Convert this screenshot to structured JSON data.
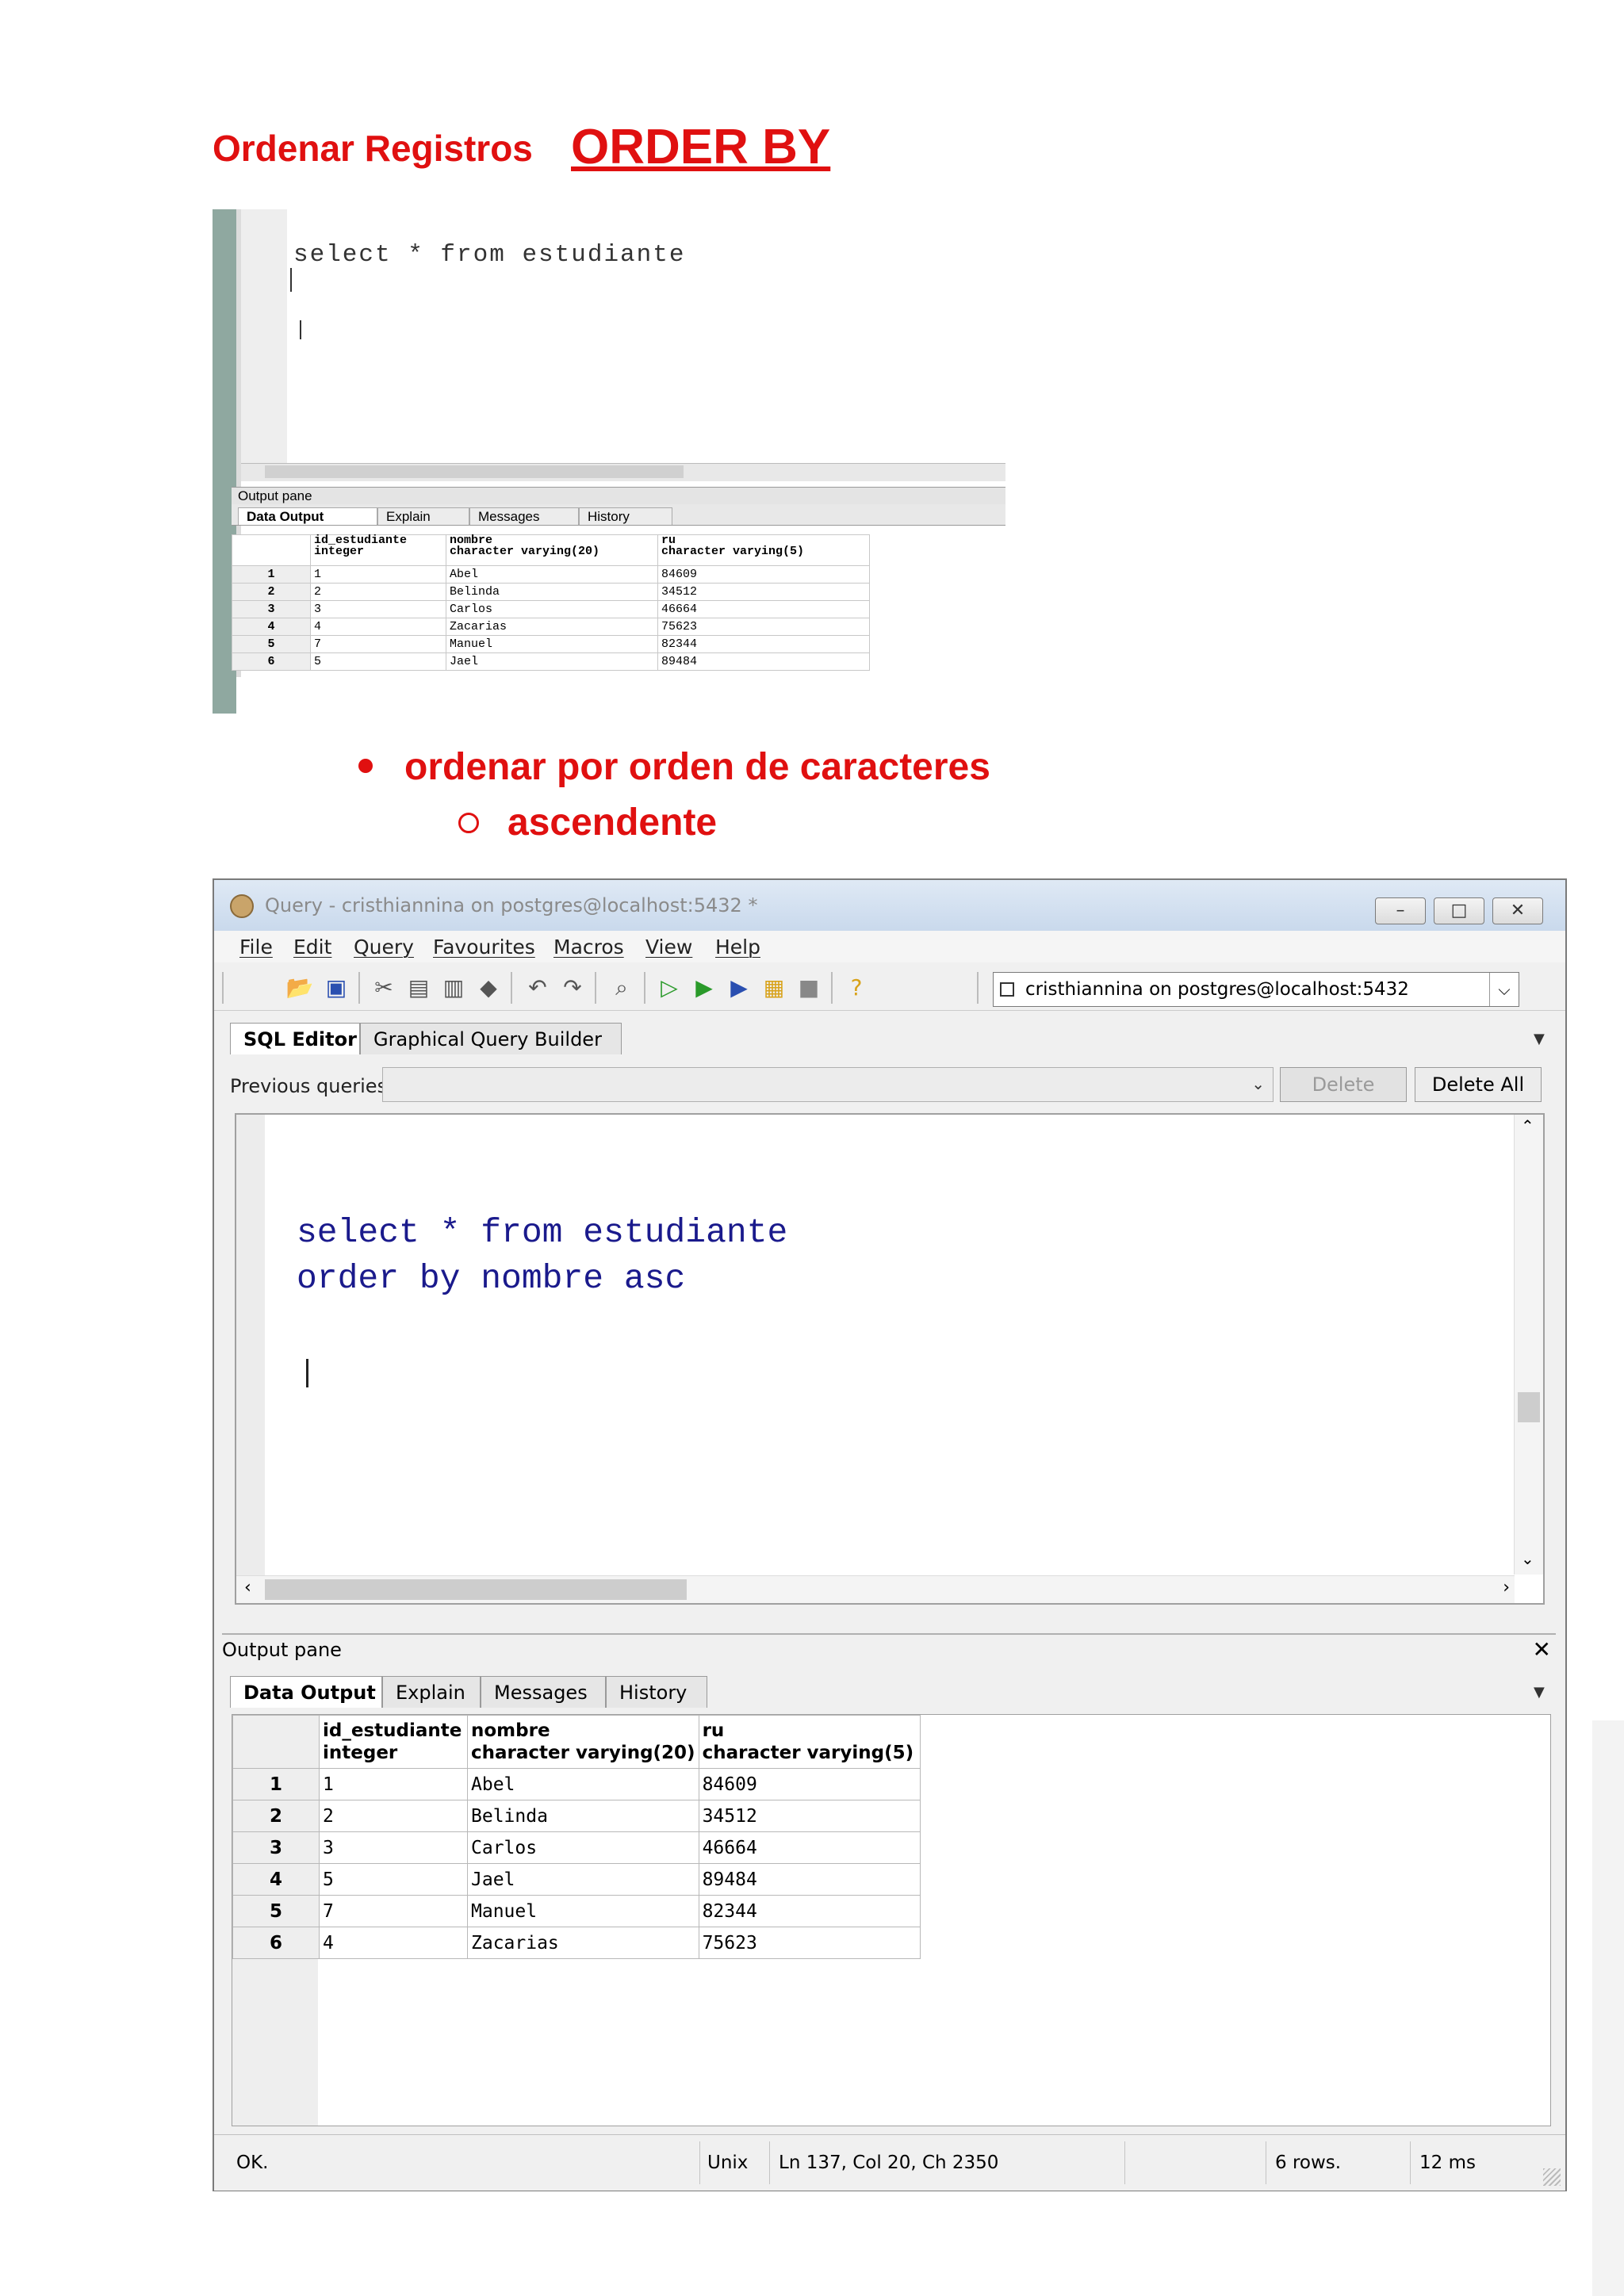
{
  "heading": {
    "title": "Ordenar  Registros",
    "keyword": "ORDER BY"
  },
  "small_shot": {
    "query": "select * from estudiante",
    "output_pane_label": "Output pane",
    "tabs": [
      "Data Output",
      "Explain",
      "Messages",
      "History"
    ],
    "columns": [
      {
        "name": "id_estudiante",
        "type": "integer"
      },
      {
        "name": "nombre",
        "type": "character varying(20)"
      },
      {
        "name": "ru",
        "type": "character varying(5)"
      }
    ],
    "rows": [
      [
        "1",
        "1",
        "Abel",
        "84609"
      ],
      [
        "2",
        "2",
        "Belinda",
        "34512"
      ],
      [
        "3",
        "3",
        "Carlos",
        "46664"
      ],
      [
        "4",
        "4",
        "Zacarias",
        "75623"
      ],
      [
        "5",
        "7",
        "Manuel",
        "82344"
      ],
      [
        "6",
        "5",
        "Jael",
        "89484"
      ]
    ]
  },
  "bullets": {
    "level1": "ordenar  por  orden  de  caracteres",
    "level2": "ascendente"
  },
  "window": {
    "title": "Query - cristhiannina on postgres@localhost:5432 *",
    "menu": [
      "File",
      "Edit",
      "Query",
      "Favourites",
      "Macros",
      "View",
      "Help"
    ],
    "connection": "cristhiannina on postgres@localhost:5432",
    "editor_tabs": [
      "SQL Editor",
      "Graphical Query Builder"
    ],
    "previous_queries_label": "Previous queries",
    "delete_label": "Delete",
    "delete_all_label": "Delete All",
    "query_line1": "select * from estudiante",
    "query_line2": "order by nombre asc",
    "output_pane_label": "Output pane",
    "output_tabs": [
      "Data Output",
      "Explain",
      "Messages",
      "History"
    ],
    "columns": [
      {
        "name": "id_estudiante",
        "type": "integer"
      },
      {
        "name": "nombre",
        "type": "character varying(20)"
      },
      {
        "name": "ru",
        "type": "character varying(5)"
      }
    ],
    "rows": [
      [
        "1",
        "1",
        "Abel",
        "84609"
      ],
      [
        "2",
        "2",
        "Belinda",
        "34512"
      ],
      [
        "3",
        "3",
        "Carlos",
        "46664"
      ],
      [
        "4",
        "5",
        "Jael",
        "89484"
      ],
      [
        "5",
        "7",
        "Manuel",
        "82344"
      ],
      [
        "6",
        "4",
        "Zacarias",
        "75623"
      ]
    ],
    "status": {
      "state": "OK.",
      "encoding": "Unix",
      "position": "Ln 137, Col 20, Ch 2350",
      "rows": "6 rows.",
      "time": "12 ms"
    }
  },
  "icons": [
    "app-icon",
    "open-icon",
    "save-icon",
    "cut-icon",
    "copy-icon",
    "paste-icon",
    "clear-icon",
    "undo-icon",
    "redo-icon",
    "find-icon",
    "execute-icon",
    "explain-icon",
    "execute-to-file-icon",
    "explain-analyze-icon",
    "stop-icon",
    "help-icon"
  ]
}
